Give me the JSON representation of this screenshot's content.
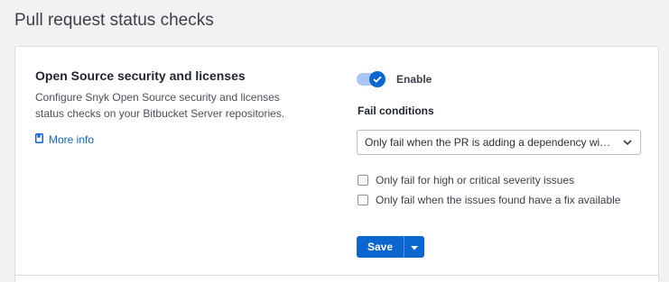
{
  "page": {
    "title": "Pull request status checks"
  },
  "section": {
    "title": "Open Source security and licenses",
    "description": "Configure Snyk Open Source security and licenses status checks on your Bitbucket Server repositories.",
    "more_info": "More info"
  },
  "toggle": {
    "label": "Enable",
    "checked": true
  },
  "fail_conditions": {
    "label": "Fail conditions",
    "selected": "Only fail when the PR is adding a dependency wi…"
  },
  "checkboxes": [
    {
      "label": "Only fail for high or critical severity issues",
      "checked": false
    },
    {
      "label": "Only fail when the issues found have a fix available",
      "checked": false
    }
  ],
  "actions": {
    "save_label": "Save"
  },
  "colors": {
    "accent": "#0b66d0",
    "toggle_track": "#a9c6f5"
  }
}
